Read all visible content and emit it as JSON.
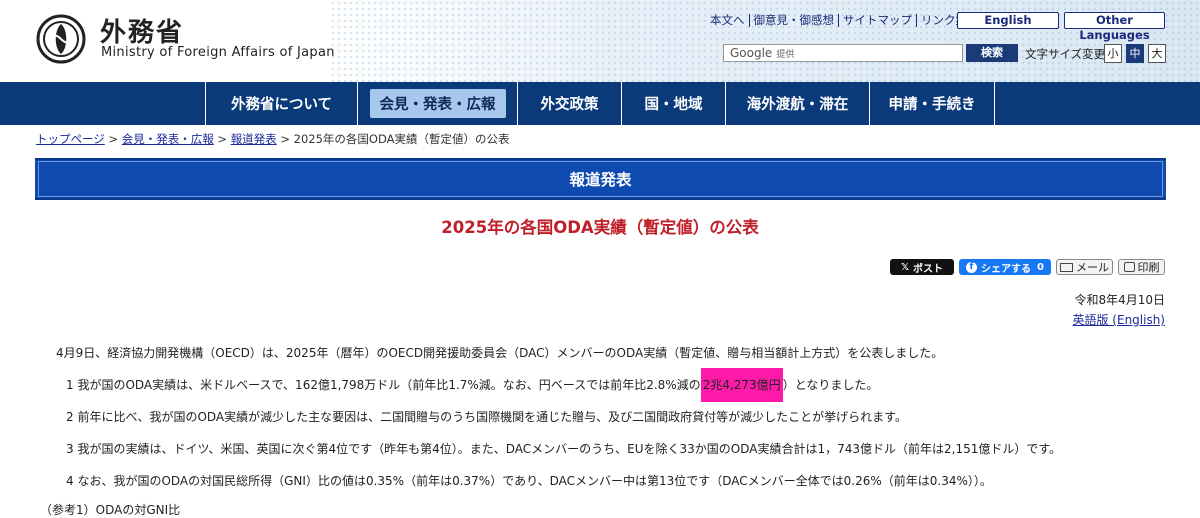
{
  "header": {
    "logo_title": "外務省",
    "logo_subtitle": "Ministry of Foreign Affairs of Japan",
    "top_links": [
      "本文へ",
      "御意見・御感想",
      "サイトマップ",
      "リンク集"
    ],
    "lang_english": "English",
    "lang_other": "Other Languages",
    "search_google": "Google",
    "search_provided": "提供",
    "search_button": "検索",
    "font_size_label": "文字サイズ変更",
    "font_sizes": [
      "小",
      "中",
      "大"
    ]
  },
  "nav": {
    "items": [
      "外務省について",
      "会見・発表・広報",
      "外交政策",
      "国・地域",
      "海外渡航・滞在",
      "申請・手続き"
    ],
    "active_index": 1
  },
  "breadcrumb": {
    "items": [
      "トップページ",
      "会見・発表・広報",
      "報道発表"
    ],
    "current": "2025年の各国ODA実績（暫定値）の公表"
  },
  "banner": "報道発表",
  "page_title": "2025年の各国ODA実績（暫定値）の公表",
  "share": {
    "x_post": "ポスト",
    "fb_share": "シェアする",
    "fb_count": "0",
    "mail": "メール",
    "print": "印刷"
  },
  "date": "令和8年4月10日",
  "english_version_link": "英語版 (English)",
  "body": {
    "intro": "4月9日、経済協力開発機構（OECD）は、2025年（暦年）のOECD開発援助委員会（DAC）メンバーのODA実績（暫定値、贈与相当額計上方式）を公表しました。",
    "p1_before": "1  我が国のODA実績は、米ドルベースで、162億1,798万ドル（前年比1.7%減。なお、円ベースでは前年比2.8%減の",
    "p1_highlight": "2兆4,273億円",
    "p1_after": "）となりました。",
    "p2": "2  前年に比べ、我が国のODA実績が減少した主な要因は、二国間贈与のうち国際機関を通じた贈与、及び二国間政府貸付等が減少したことが挙げられます。",
    "p3": "3  我が国の実績は、ドイツ、米国、英国に次ぐ第4位です（昨年も第4位）。また、DACメンバーのうち、EUを除く33か国のODA実績合計は1，743億ドル（前年は2,151億ドル）です。",
    "p4": "4  なお、我が国のODAの対国民総所得（GNI）比の値は0.35%（前年は0.37%）であり、DACメンバー中は第13位です（DACメンバー全体では0.26%（前年は0.34%））。",
    "reference": "（参考1）ODAの対GNI比"
  },
  "colors": {
    "nav_bg": "#0b3a7a",
    "banner_bg": "#0f4ab0",
    "title_red": "#c0202a",
    "highlight": "#ff1aaa"
  }
}
